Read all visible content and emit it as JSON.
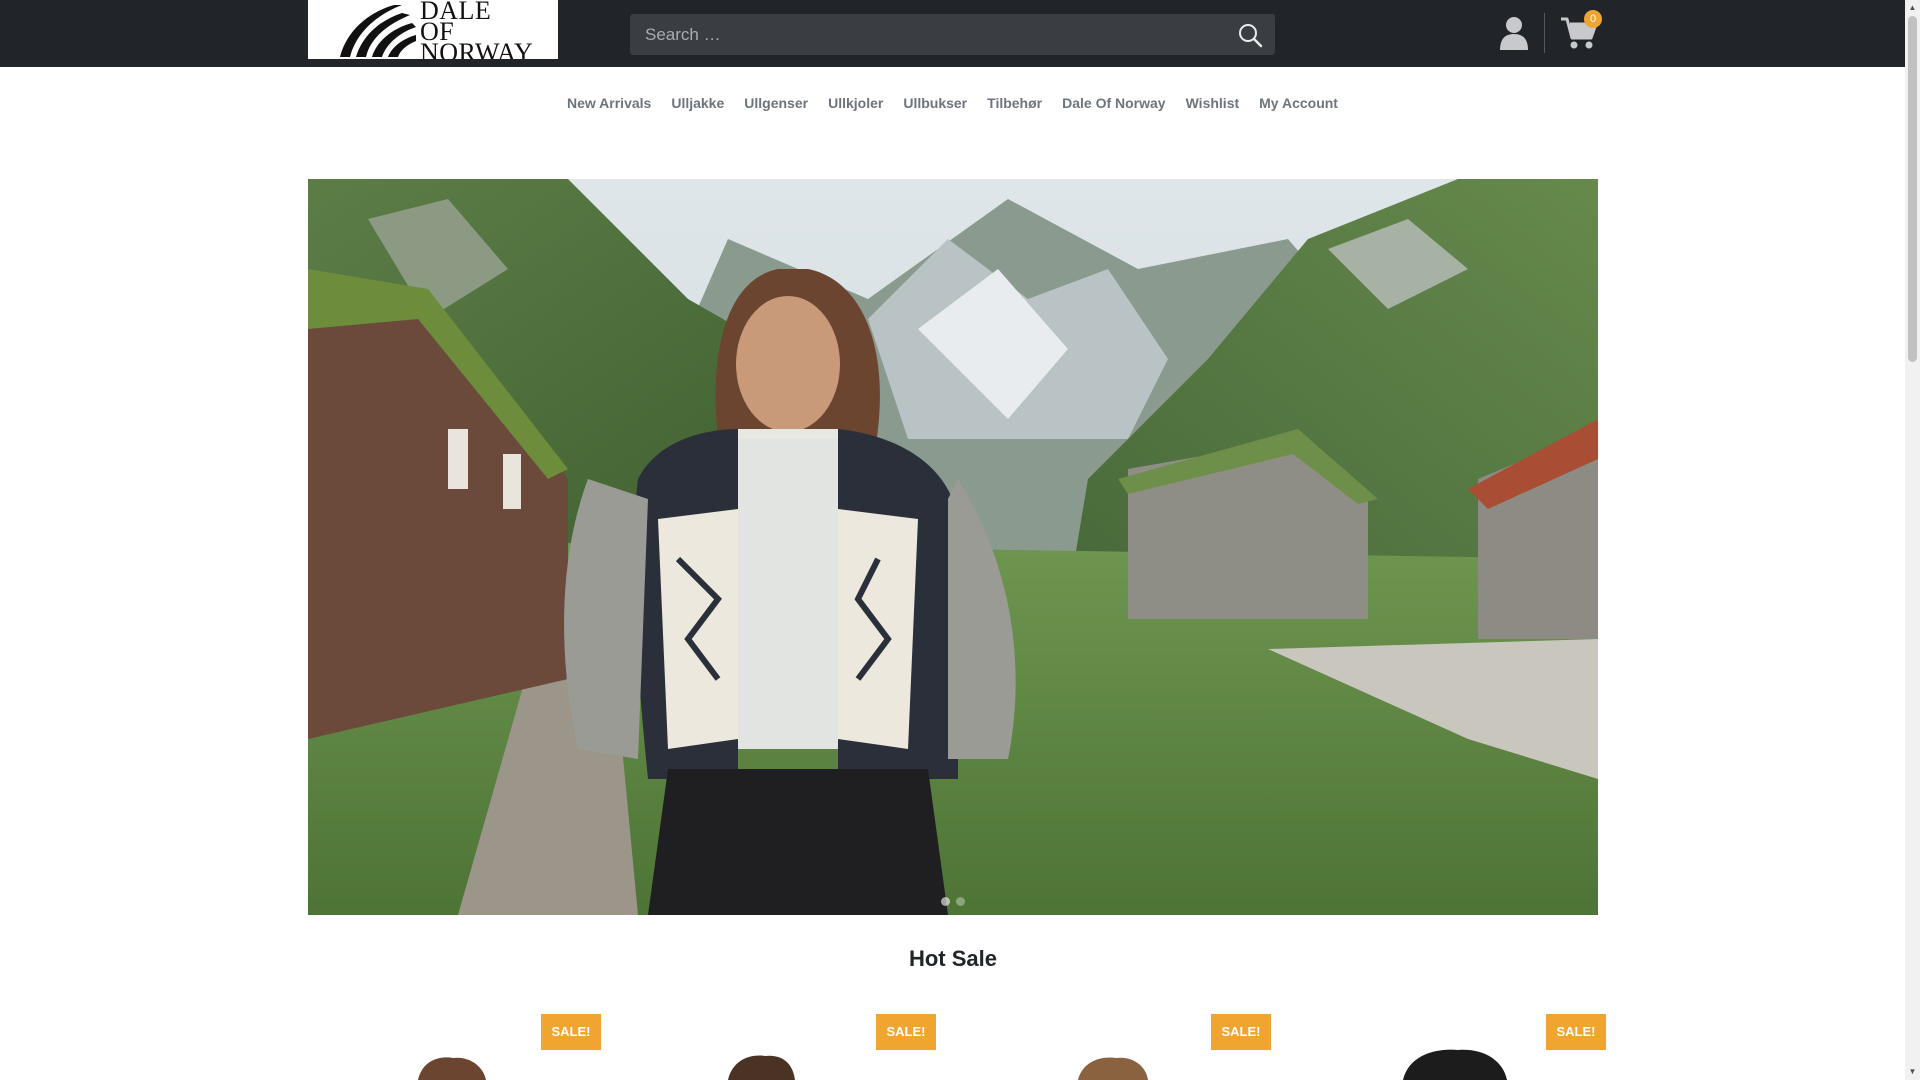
{
  "brand": {
    "logo_line1": "DALE",
    "logo_line2": "OF",
    "logo_line3": "NORWAY"
  },
  "search": {
    "placeholder": "Search …"
  },
  "cart": {
    "count": "0"
  },
  "nav": {
    "items": [
      {
        "label": "New Arrivals"
      },
      {
        "label": "Ulljakke"
      },
      {
        "label": "Ullgenser"
      },
      {
        "label": "Ullkjoler"
      },
      {
        "label": "Ullbukser"
      },
      {
        "label": "Tilbehør"
      },
      {
        "label": "Dale Of Norway"
      },
      {
        "label": "Wishlist"
      },
      {
        "label": "My Account"
      }
    ]
  },
  "section": {
    "title": "Hot Sale"
  },
  "products": [
    {
      "badge": "SALE!"
    },
    {
      "badge": "SALE!"
    },
    {
      "badge": "SALE!"
    },
    {
      "badge": "SALE!"
    }
  ],
  "colors": {
    "topbar": "#212529",
    "accent": "#f0a531",
    "nav_text": "#6c757d"
  },
  "icons": {
    "search": "search-icon",
    "account": "user-icon",
    "cart": "shopping-cart-icon"
  }
}
